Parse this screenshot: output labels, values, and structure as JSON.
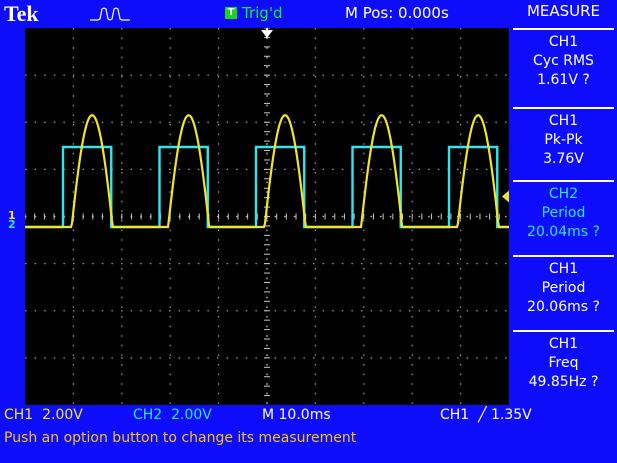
{
  "header": {
    "brand": "Tek",
    "acquire_icon": "pulse-icon",
    "trigger_badge": "T",
    "trigger_status": "Trig'd",
    "main_position": "M Pos: 0.000s"
  },
  "measure_panel": {
    "title": "MEASURE",
    "measurements": [
      {
        "source": "CH1",
        "type": "Cyc RMS",
        "value": "1.61V ?",
        "color": "#ffffff"
      },
      {
        "source": "CH1",
        "type": "Pk-Pk",
        "value": "3.76V",
        "color": "#ffffff"
      },
      {
        "source": "CH2",
        "type": "Period",
        "value": "20.04ms ?",
        "color": "#2ee6f0"
      },
      {
        "source": "CH1",
        "type": "Period",
        "value": "20.06ms ?",
        "color": "#ffffff"
      },
      {
        "source": "CH1",
        "type": "Freq",
        "value": "49.85Hz ?",
        "color": "#ffffff"
      }
    ]
  },
  "status_bar": {
    "ch1_scale": "CH1  2.00V",
    "ch2_scale": "CH2  2.00V",
    "timebase": "M 10.0ms",
    "trigger": "CH1  ╱ 1.35V"
  },
  "message": "Push an option button to change its measurement",
  "channel_markers": {
    "ch1": "1",
    "ch2": "2"
  },
  "colors": {
    "ch1": "#f1e42a",
    "ch2": "#2ee6f0",
    "background": "#0d0dfb",
    "screen": "#000000"
  }
}
